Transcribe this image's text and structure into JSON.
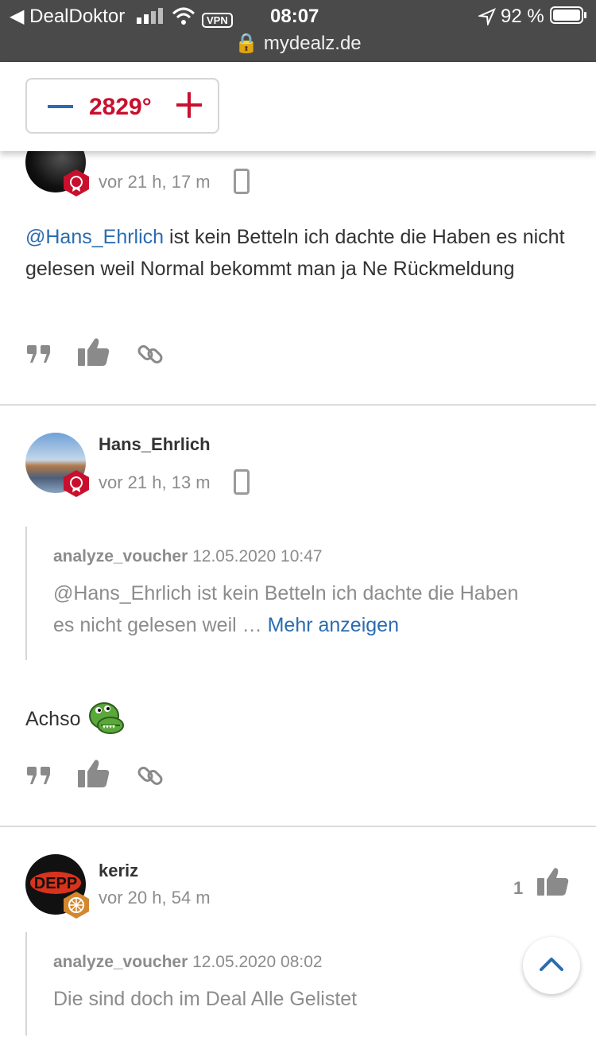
{
  "statusbar": {
    "back_app": "DealDoktor",
    "vpn": "VPN",
    "time": "08:07",
    "battery": "92 %",
    "url": "mydealz.de"
  },
  "topbar": {
    "temperature": "2829°",
    "minus_icon": "minus-icon",
    "plus_icon": "plus-icon"
  },
  "comments": [
    {
      "time": "vor 21 h, 17 m",
      "mention": "@Hans_Ehrlich",
      "text": " ist kein Betteln ich dachte die Haben es nicht gelesen weil Normal bekommt man ja Ne Rückmeldung"
    },
    {
      "username": "Hans_Ehrlich",
      "time": "vor 21 h, 13 m",
      "quote_author": "analyze_voucher",
      "quote_date": "12.05.2020 10:47",
      "quote_text": "@Hans_Ehrlich ist kein Betteln ich dachte die Haben es nicht gelesen weil … ",
      "quote_more": "Mehr anzeigen",
      "text": "Achso"
    },
    {
      "username": "keriz",
      "time": "vor 20 h, 54 m",
      "likes": "1",
      "quote_author": "analyze_voucher",
      "quote_date": "12.05.2020 08:02",
      "quote_text": "Die sind doch im Deal Alle Gelistet"
    }
  ],
  "colors": {
    "accent_blue": "#2b6cb0",
    "hot_red": "#c8102e",
    "muted": "#8c8c8c"
  }
}
